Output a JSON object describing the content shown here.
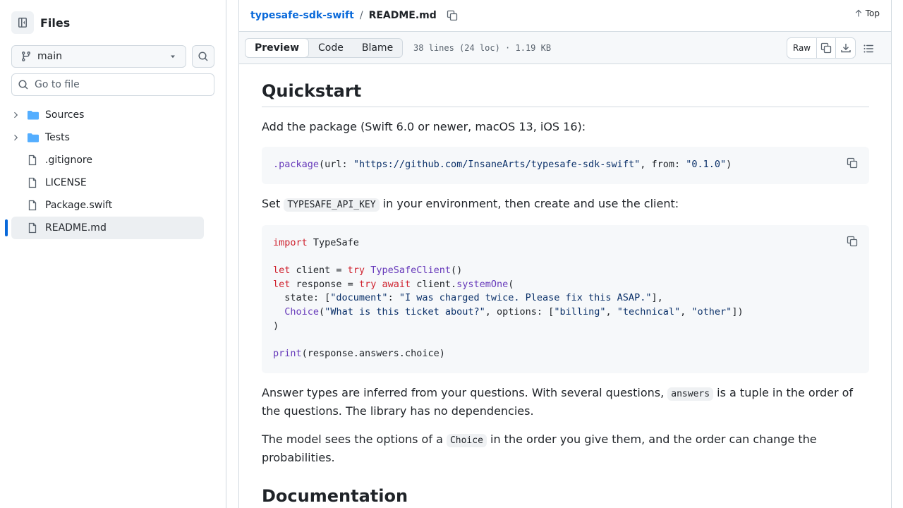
{
  "sidebar": {
    "title": "Files",
    "branch": "main",
    "goto_placeholder": "Go to file",
    "items": [
      {
        "label": "Sources",
        "type": "folder"
      },
      {
        "label": "Tests",
        "type": "folder"
      },
      {
        "label": ".gitignore",
        "type": "file"
      },
      {
        "label": "LICENSE",
        "type": "file"
      },
      {
        "label": "Package.swift",
        "type": "file"
      },
      {
        "label": "README.md",
        "type": "file",
        "selected": true
      }
    ]
  },
  "header": {
    "repo": "typesafe-sdk-swift",
    "separator": "/",
    "file": "README.md",
    "top_label": "Top"
  },
  "file_header": {
    "tabs": [
      "Preview",
      "Code",
      "Blame"
    ],
    "active_tab": "Preview",
    "meta": "38 lines (24 loc) · 1.19 KB",
    "raw_label": "Raw"
  },
  "content": {
    "h_quickstart": "Quickstart",
    "p_add": "Add the package (Swift 6.0 or newer, macOS 13, iOS 16):",
    "code1": {
      "method": ".package",
      "p1": "(url: ",
      "url": "\"https://github.com/InsaneArts/typesafe-sdk-swift\"",
      "p2": ", from: ",
      "ver": "\"0.1.0\"",
      "p3": ")"
    },
    "p_set_a": "Set ",
    "p_set_code": "TYPESAFE_API_KEY",
    "p_set_b": " in your environment, then create and use the client:",
    "code2": {
      "l1_k": "import",
      "l1_r": " TypeSafe",
      "l3_k": "let",
      "l3_a": " client = ",
      "l3_k2": "try",
      "l3_f": " TypeSafeClient",
      "l3_b": "()",
      "l4_k": "let",
      "l4_a": " response = ",
      "l4_k2": "try",
      "l4_k3": " await",
      "l4_b": " client.",
      "l4_f": "systemOne",
      "l4_c": "(",
      "l5_a": "  state: [",
      "l5_s1": "\"document\"",
      "l5_b": ": ",
      "l5_s2": "\"I was charged twice. Please fix this ASAP.\"",
      "l5_c": "],",
      "l6_a": "  ",
      "l6_f": "Choice",
      "l6_b": "(",
      "l6_s1": "\"What is this ticket about?\"",
      "l6_c": ", options: [",
      "l6_s2": "\"billing\"",
      "l6_d": ", ",
      "l6_s3": "\"technical\"",
      "l6_e": ", ",
      "l6_s4": "\"other\"",
      "l6_g": "])",
      "l7": ")",
      "l9_f": "print",
      "l9_a": "(response.answers.choice)"
    },
    "p_answers_a": "Answer types are inferred from your questions. With several questions, ",
    "p_answers_code": "answers",
    "p_answers_b": " is a tuple in the order of the questions. The library has no dependencies.",
    "p_model_a": "The model sees the options of a ",
    "p_model_code": "Choice",
    "p_model_b": " in the order you give them, and the order can change the probabilities.",
    "h_docs": "Documentation"
  },
  "colors": {
    "accent": "#0969da",
    "keyword": "#cf222e",
    "function": "#6639ba",
    "string": "#0a3069",
    "folder": "#54aeff"
  }
}
